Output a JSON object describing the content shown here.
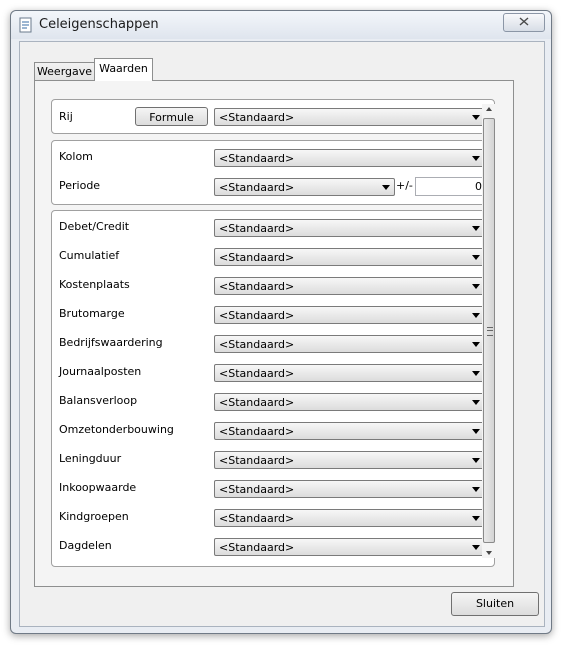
{
  "window": {
    "title": "Celeigenschappen"
  },
  "tabs": [
    {
      "label": "Weergave"
    },
    {
      "label": "Waarden"
    }
  ],
  "rij": {
    "label": "Rij",
    "button": "Formule",
    "value": "<Standaard>"
  },
  "kolom": {
    "label": "Kolom",
    "value": "<Standaard>"
  },
  "periode": {
    "label": "Periode",
    "value": "<Standaard>",
    "plusminus": "+/-",
    "offset": "0"
  },
  "fields": [
    {
      "label": "Debet/Credit",
      "value": "<Standaard>"
    },
    {
      "label": "Cumulatief",
      "value": "<Standaard>"
    },
    {
      "label": "Kostenplaats",
      "value": "<Standaard>"
    },
    {
      "label": "Brutomarge",
      "value": "<Standaard>"
    },
    {
      "label": "Bedrijfswaardering",
      "value": "<Standaard>"
    },
    {
      "label": "Journaalposten",
      "value": "<Standaard>"
    },
    {
      "label": "Balansverloop",
      "value": "<Standaard>"
    },
    {
      "label": "Omzetonderbouwing",
      "value": "<Standaard>"
    },
    {
      "label": "Leningduur",
      "value": "<Standaard>"
    },
    {
      "label": "Inkoopwaarde",
      "value": "<Standaard>"
    },
    {
      "label": "Kindgroepen",
      "value": "<Standaard>"
    },
    {
      "label": "Dagdelen",
      "value": "<Standaard>"
    }
  ],
  "footer": {
    "close_label": "Sluiten"
  },
  "icons": {
    "app": "document-properties-icon",
    "close": "close-icon"
  }
}
